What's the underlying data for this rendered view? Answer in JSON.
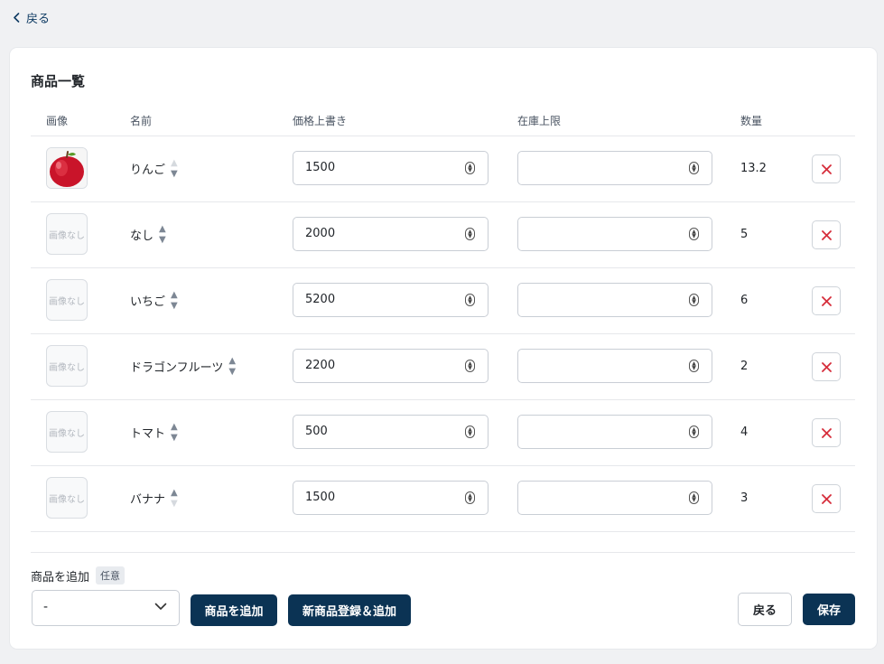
{
  "nav": {
    "back_label": "戻る"
  },
  "section_title": "商品一覧",
  "columns": {
    "image": "画像",
    "name": "名前",
    "price": "価格上書き",
    "stock": "在庫上限",
    "qty": "数量"
  },
  "no_image_label": "画像なし",
  "products": [
    {
      "name": "りんご",
      "price": "1500",
      "stock": "",
      "qty": "13.2",
      "has_image": true,
      "up_enabled": false,
      "down_enabled": true
    },
    {
      "name": "なし",
      "price": "2000",
      "stock": "",
      "qty": "5",
      "has_image": false,
      "up_enabled": true,
      "down_enabled": true
    },
    {
      "name": "いちご",
      "price": "5200",
      "stock": "",
      "qty": "6",
      "has_image": false,
      "up_enabled": true,
      "down_enabled": true
    },
    {
      "name": "ドラゴンフルーツ",
      "price": "2200",
      "stock": "",
      "qty": "2",
      "has_image": false,
      "up_enabled": true,
      "down_enabled": true
    },
    {
      "name": "トマト",
      "price": "500",
      "stock": "",
      "qty": "4",
      "has_image": false,
      "up_enabled": true,
      "down_enabled": true
    },
    {
      "name": "バナナ",
      "price": "1500",
      "stock": "",
      "qty": "3",
      "has_image": false,
      "up_enabled": true,
      "down_enabled": false
    }
  ],
  "add_product": {
    "label": "商品を追加",
    "badge": "任意",
    "select_value": "-",
    "add_button": "商品を追加",
    "register_button": "新商品登録＆追加"
  },
  "footer": {
    "back_button": "戻る",
    "save_button": "保存"
  },
  "colors": {
    "primary": "#0b3354",
    "delete": "#d62d3b",
    "link": "#0f3b63"
  }
}
